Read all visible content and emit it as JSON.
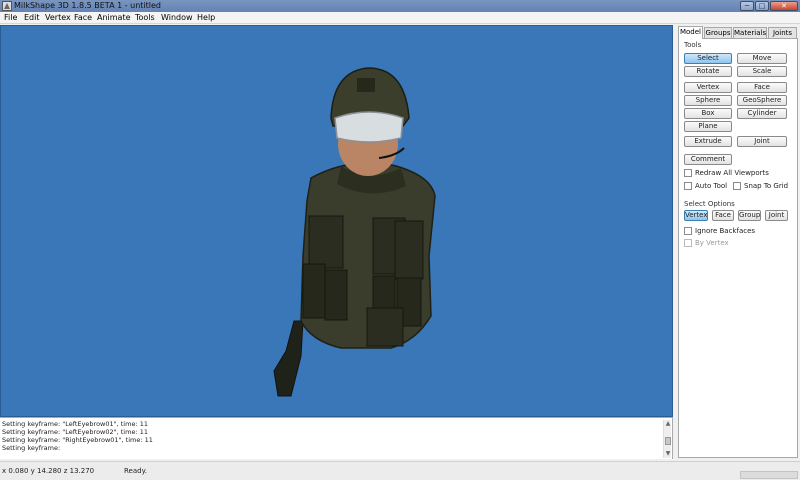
{
  "window": {
    "title": "MilkShape 3D 1.8.5 BETA 1 - untitled",
    "min_symbol": "─",
    "max_symbol": "□",
    "close_symbol": "✕"
  },
  "menu": [
    "File",
    "Edit",
    "Vertex",
    "Face",
    "Animate",
    "Tools",
    "Window",
    "Help"
  ],
  "panel": {
    "tabs": [
      "Model",
      "Groups",
      "Materials",
      "Joints"
    ],
    "active_tab": "Model",
    "tools_label": "Tools",
    "tools": {
      "select": "Select",
      "move": "Move",
      "rotate": "Rotate",
      "scale": "Scale",
      "vertex": "Vertex",
      "face": "Face",
      "sphere": "Sphere",
      "geosphere": "GeoSphere",
      "box": "Box",
      "cylinder": "Cylinder",
      "plane": "Plane",
      "extrude": "Extrude",
      "joint": "Joint",
      "comment": "Comment"
    },
    "checks": {
      "redraw_all": "Redraw All Viewports",
      "auto_tool": "Auto Tool",
      "snap_to_grid": "Snap To Grid"
    },
    "select_options_label": "Select Options",
    "select_options": {
      "vertex": "Vertex",
      "face": "Face",
      "group": "Group",
      "joint": "Joint"
    },
    "ignore_backfaces": "Ignore Backfaces",
    "by_vertex": "By Vertex"
  },
  "log": {
    "lines": [
      "Setting keyframe: \"LeftEyebrow01\", time: 11",
      "Setting keyframe: \"LeftEyebrow02\", time: 11",
      "Setting keyframe: \"RightEyebrow01\", time: 11",
      "Setting keyframe:"
    ]
  },
  "status": {
    "coords": "x 0.080 y 14.280 z 13.270",
    "state": "Ready."
  },
  "colors": {
    "viewport_bg": "#3a77b9",
    "active_button": "#8cc6f0"
  }
}
